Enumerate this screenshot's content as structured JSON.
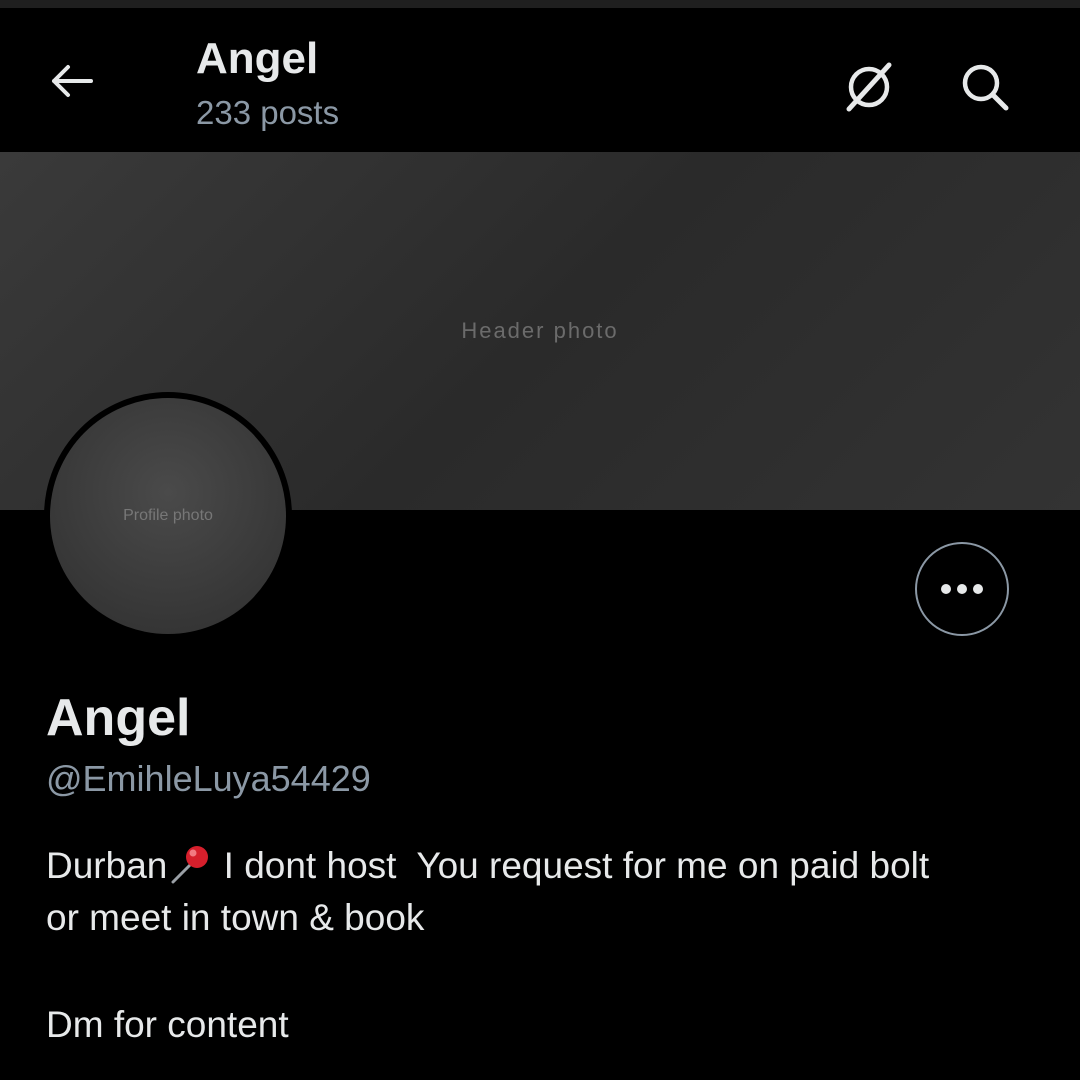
{
  "header": {
    "title": "Angel",
    "posts_count": "233 posts",
    "back_icon": "back-arrow-icon",
    "grok_icon": "grok-icon",
    "search_icon": "search-icon"
  },
  "banner": {
    "placeholder": "Header photo"
  },
  "avatar": {
    "placeholder": "Profile photo"
  },
  "profile": {
    "display_name": "Angel",
    "handle": "@EmihleLuya54429",
    "bio_line1_a": "Durban",
    "bio_line1_b": " I dont host  You request for me on paid bolt",
    "bio_line2": "or meet in town & book",
    "bio_cta": "Dm for content"
  },
  "colors": {
    "background": "#000000",
    "text_primary": "#e7e9ea",
    "text_secondary": "#8b98a5",
    "pin_red": "#d61f2c"
  }
}
